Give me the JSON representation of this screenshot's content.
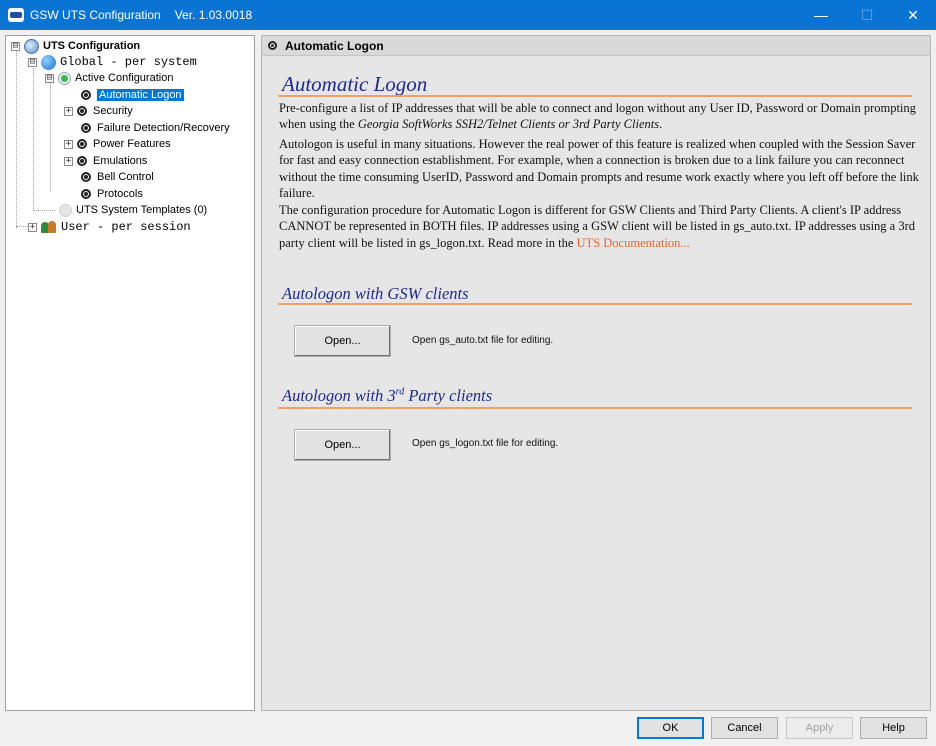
{
  "window": {
    "title": "GSW UTS Configuration",
    "version": "Ver. 1.03.0018",
    "controls": {
      "minimize": "—",
      "maximize": "☐",
      "close": "✕"
    }
  },
  "tree": {
    "items": [
      {
        "label": "UTS Configuration",
        "expander": "⊟"
      },
      {
        "label": "Global  -  per system",
        "expander": "⊟"
      },
      {
        "label": "Active Configuration",
        "expander": "⊟"
      },
      {
        "label": "Automatic Logon"
      },
      {
        "label": "Security",
        "expander": "+"
      },
      {
        "label": "Failure Detection/Recovery"
      },
      {
        "label": "Power Features",
        "expander": "+"
      },
      {
        "label": "Emulations",
        "expander": "+"
      },
      {
        "label": "Bell Control"
      },
      {
        "label": "Protocols"
      },
      {
        "label": "UTS System Templates (0)"
      },
      {
        "label": "User  -  per session",
        "expander": "+"
      }
    ]
  },
  "content": {
    "header": "Automatic Logon",
    "title": "Automatic Logon",
    "para1_a": "Pre-configure a list of IP addresses that will be able to connect and logon without any User ID, Password or Domain prompting when using the ",
    "para1_b": "Georgia SoftWorks SSH2/Telnet Clients or 3rd Party Clients",
    "para1_c": ".",
    "para2": "Autologon is useful in many situations. However the real power of this feature is realized when coupled with the Session Saver for fast and easy connection establishment. For example, when a connection is broken due to a link failure you can reconnect without the time consuming UserID, Password and Domain prompts and resume work exactly where you left off before the link failure.",
    "para3": "The configuration procedure for Automatic Logon is different for GSW Clients and Third Party Clients. A client's IP address CANNOT be represented in BOTH files. IP addresses using a GSW client will be listed in gs_auto.txt. IP addresses using a 3rd party client will be listed in gs_logon.txt. Read more in the ",
    "para3_link": "UTS Documentation...",
    "section_gsw": {
      "title": "Autologon with GSW clients",
      "button": "Open...",
      "description": "Open gs_auto.txt file for editing."
    },
    "section_3rd": {
      "title_a": "Autologon with 3",
      "title_sup": "rd",
      "title_b": " Party clients",
      "button": "Open...",
      "description": "Open gs_logon.txt file for editing."
    }
  },
  "buttons": {
    "ok": "OK",
    "cancel": "Cancel",
    "apply": "Apply",
    "help": "Help"
  },
  "colors": {
    "titlebar": "#0a74d4",
    "heading": "#1f2a8a",
    "accent_rule": "#f0a060",
    "link": "#e8652a",
    "selection": "#0078d7"
  }
}
